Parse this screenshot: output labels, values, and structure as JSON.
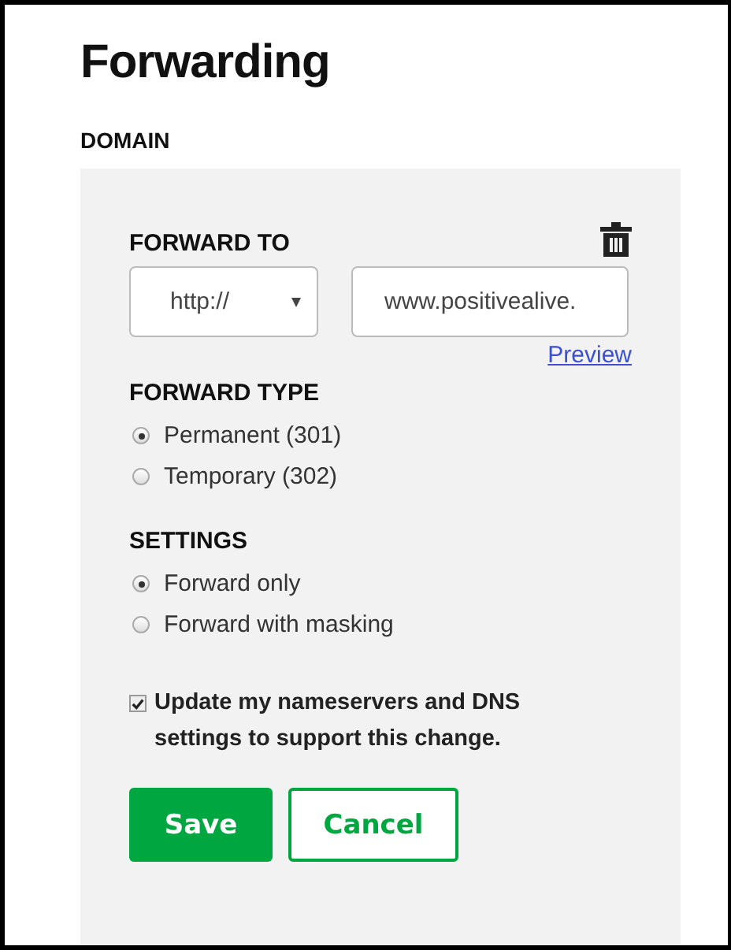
{
  "title": "Forwarding",
  "section_label": "DOMAIN",
  "forward_to": {
    "label": "FORWARD TO",
    "protocol": "http://",
    "url": "www.positivealive.",
    "preview_link": "Preview"
  },
  "forward_type": {
    "label": "FORWARD TYPE",
    "options": [
      {
        "label": "Permanent (301)",
        "selected": true
      },
      {
        "label": "Temporary (302)",
        "selected": false
      }
    ]
  },
  "settings": {
    "label": "SETTINGS",
    "options": [
      {
        "label": "Forward only",
        "selected": true
      },
      {
        "label": "Forward with masking",
        "selected": false
      }
    ]
  },
  "update_dns": {
    "label": "Update my nameservers and DNS settings to support this change.",
    "checked": true
  },
  "buttons": [
    {
      "label": "Save",
      "kind": "primary"
    },
    {
      "label": "Cancel",
      "kind": "secondary"
    }
  ]
}
